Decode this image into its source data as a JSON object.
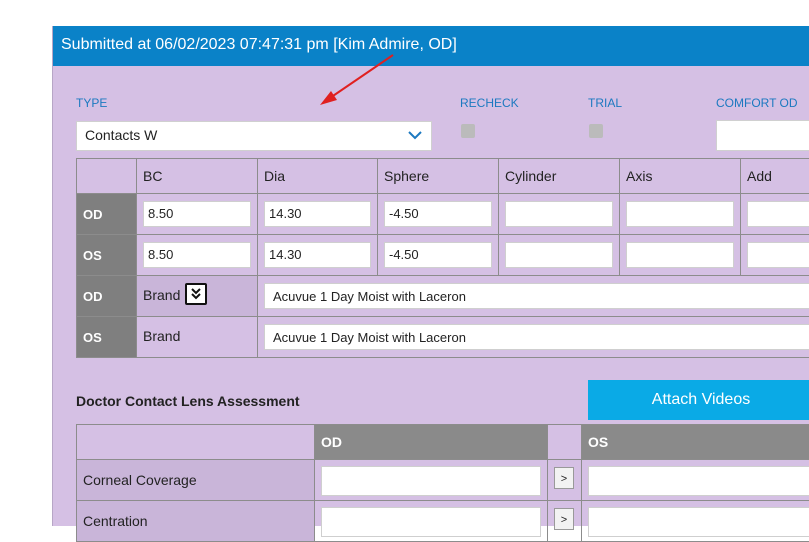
{
  "header": {
    "title": "Submitted at 06/02/2023 07:47:31 pm [Kim Admire, OD]"
  },
  "form": {
    "type_label": "TYPE",
    "type_value": "Contacts W",
    "recheck_label": "RECHECK",
    "trial_label": "TRIAL",
    "comfort_label": "COMFORT OD"
  },
  "rx_table": {
    "headers": [
      "BC",
      "Dia",
      "Sphere",
      "Cylinder",
      "Axis",
      "Add"
    ],
    "rows": [
      {
        "eye": "OD",
        "values": [
          "8.50",
          "14.30",
          "-4.50",
          "",
          "",
          ""
        ]
      },
      {
        "eye": "OS",
        "values": [
          "8.50",
          "14.30",
          "-4.50",
          "",
          "",
          ""
        ]
      }
    ],
    "brand_rows": [
      {
        "eye": "OD",
        "label": "Brand",
        "value": "Acuvue 1 Day Moist with Laceron"
      },
      {
        "eye": "OS",
        "label": "Brand",
        "value": "Acuvue 1 Day Moist with Laceron"
      }
    ]
  },
  "assessment": {
    "title": "Doctor Contact Lens Assessment",
    "attach_button": "Attach Videos",
    "col_od": "OD",
    "col_os": "OS",
    "copy_button": ">",
    "rows": [
      "Corneal Coverage",
      "Centration"
    ]
  },
  "colors": {
    "header_bg": "#0a82c8",
    "panel_bg": "#d5c0e4",
    "accent": "#0aaae6",
    "annotation_arrow": "#e02020"
  }
}
